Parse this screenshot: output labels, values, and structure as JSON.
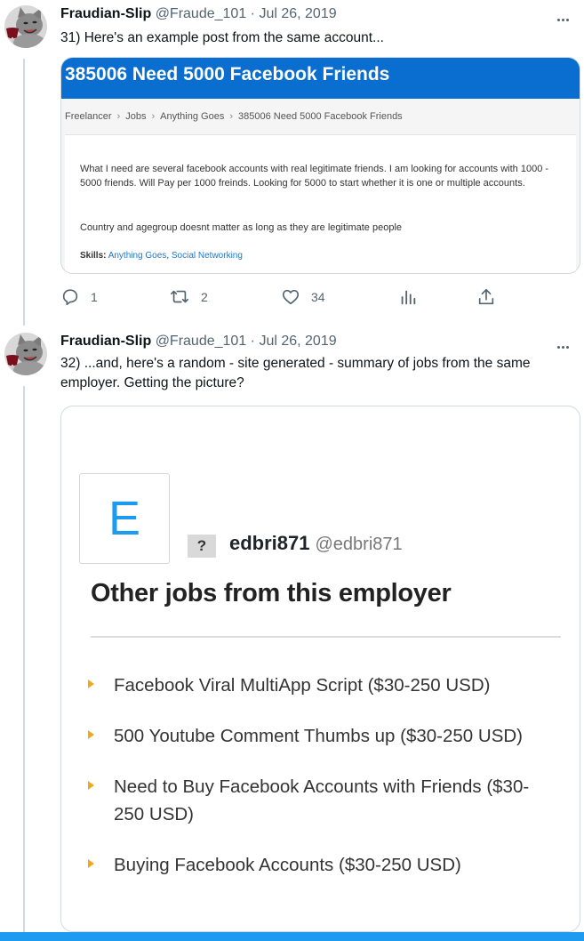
{
  "tweets": [
    {
      "author_name": "Fraudian-Slip",
      "meta": "@Fraude_101 · Jul 26, 2019",
      "text": "31) Here's an example post from the same account...",
      "card": {
        "title": "385006 Need 5000 Facebook Friends",
        "breadcrumbs": [
          "Freelancer",
          "Jobs",
          "Anything Goes",
          "385006 Need 5000 Facebook Friends"
        ],
        "breadcrumb_separator": "›",
        "description_1": "What I need are several facebook accounts with real legitimate friends. I am looking for accounts with 1000 - 5000 friends. Will Pay per 1000 freinds. Looking for 5000 to start whether it is one or multiple accounts.",
        "description_2": "Country and agegroup doesnt matter as long as they are legitimate people",
        "skills_label": "Skills:",
        "skills": [
          "Anything Goes",
          "Social Networking"
        ],
        "skills_separator": ", "
      },
      "actions": {
        "reply_count": "1",
        "retweet_count": "2",
        "like_count": "34"
      }
    },
    {
      "author_name": "Fraudian-Slip",
      "meta": "@Fraude_101 · Jul 26, 2019",
      "text": "32) ...and, here's a random - site generated - summary of jobs from the same employer. Getting the picture?",
      "card": {
        "logo_letter": "E",
        "unknown_badge": "?",
        "employer_name": "edbri871",
        "employer_handle": "@edbri871",
        "heading": "Other jobs from this employer",
        "jobs": [
          "Facebook Viral MultiApp Script ($30-250 USD)",
          "500 Youtube Comment Thumbs up ($30-250 USD)",
          "Need to Buy Facebook Accounts with Friends ($30-250 USD)",
          "Buying Facebook Accounts ($30-250 USD)"
        ]
      }
    }
  ],
  "icons": {
    "reply": "reply-icon",
    "retweet": "retweet-icon",
    "like": "heart-icon",
    "analytics": "analytics-icon",
    "share": "share-icon",
    "more": "more-icon"
  },
  "colors": {
    "brand_blue": "#1d9bf0",
    "card_header_blue": "#0a6dd0",
    "bullet_orange": "#f0a81d",
    "muted_text": "#536471"
  }
}
